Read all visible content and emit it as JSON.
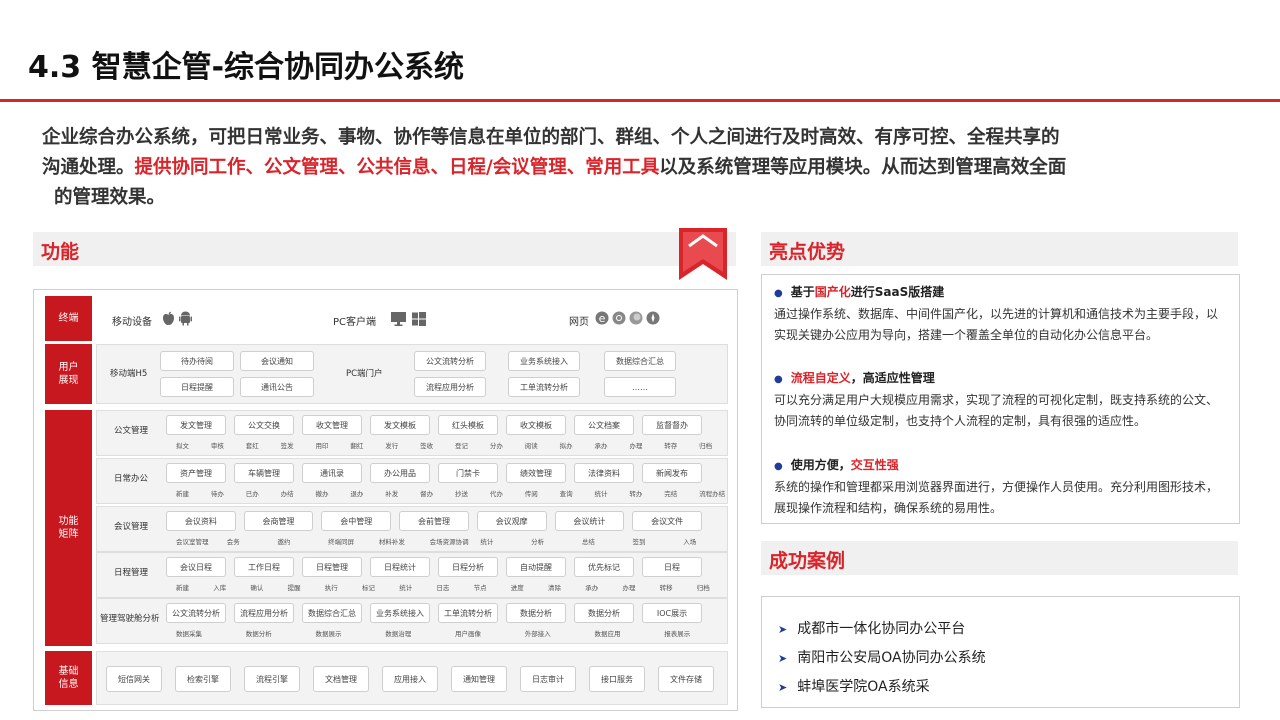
{
  "slide": {
    "title": "4.3 智慧企管-综合协同办公系统",
    "intro_line1": "企业综合办公系统，可把日常业务、事物、协作等信息在单位的部门、群组、个人之间进行及时高效、有序可控、全程共享的",
    "intro_line2_pre": "沟通处理。",
    "intro_line2_red": "提供协同工作、公文管理、公共信息、日程/会议管理、常用工具",
    "intro_line2_post": "以及系统管理等应用模块。从而达到管理高效全面",
    "intro_line3": "的管理效果。"
  },
  "function_section": {
    "title": "功能",
    "rows": {
      "terminal": {
        "label": "终端",
        "mobile": "移动设备",
        "pc": "PC客户端",
        "web": "网页"
      },
      "user_display": {
        "label": "用户\n展现",
        "left_name": "移动端H5",
        "left_items": [
          "待办待阅",
          "会议通知",
          "日程提醒",
          "通讯公告"
        ],
        "pc_portal": "PC端门户",
        "right_items": [
          "公文流转分析",
          "业务系统接入",
          "数据综合汇总",
          "流程应用分析",
          "工单流转分析",
          "……"
        ]
      },
      "function_matrix": {
        "label": "功能\n矩阵",
        "groups": [
          {
            "name": "公文管理",
            "items": [
              "发文管理",
              "公文交换",
              "收文管理",
              "发文模板",
              "红头模板",
              "收文模板",
              "公文档案",
              "监督督办"
            ],
            "subs": [
              "拟文",
              "审核",
              "套红",
              "签发",
              "用印",
              "翻红",
              "发行",
              "签收",
              "登记",
              "分办",
              "阅读",
              "拟办",
              "承办",
              "办理",
              "转存",
              "归档"
            ]
          },
          {
            "name": "日常办公",
            "items": [
              "资产管理",
              "车辆管理",
              "通讯录",
              "办公用品",
              "门禁卡",
              "绩效管理",
              "法律资料",
              "新闻发布"
            ],
            "subs": [
              "新建",
              "待办",
              "已办",
              "办结",
              "撤办",
              "退办",
              "补发",
              "督办",
              "抄送",
              "代办",
              "传阅",
              "查询",
              "统计",
              "转办",
              "完结",
              "流程办结"
            ]
          },
          {
            "name": "会议管理",
            "items": [
              "会议资料",
              "会商管理",
              "会中管理",
              "会前管理",
              "会议观摩",
              "会议统计",
              "会议文件"
            ],
            "subs": [
              "会议室管理",
              "会务",
              "邀约",
              "终端同屏",
              "材料补发",
              "会场资源协调",
              "统计",
              "分析",
              "总结",
              "签到",
              "入场"
            ]
          },
          {
            "name": "日程管理",
            "items": [
              "会议日程",
              "工作日程",
              "日程管理",
              "日程统计",
              "日程分析",
              "自动提醒",
              "优先标记",
              "日程"
            ],
            "subs": [
              "新建",
              "入库",
              "确认",
              "提醒",
              "执行",
              "标记",
              "统计",
              "日志",
              "节点",
              "进度",
              "清除",
              "承办",
              "办理",
              "转移",
              "归档"
            ]
          },
          {
            "name": "管理驾驶舱分析",
            "items": [
              "公文流转分析",
              "流程应用分析",
              "数据综合汇总",
              "业务系统接入",
              "工单流转分析",
              "数据分析",
              "数据分析",
              "IOC展示"
            ],
            "subs": [
              "数据采集",
              "数据分析",
              "数据展示",
              "数据治理",
              "用户画像",
              "外部接入",
              "数据应用",
              "报表展示"
            ]
          }
        ]
      },
      "base_info": {
        "label": "基础\n信息",
        "items": [
          "短信网关",
          "检索引擎",
          "流程引擎",
          "文档管理",
          "应用接入",
          "通知管理",
          "日志审计",
          "接口服务",
          "文件存储"
        ]
      }
    }
  },
  "highlights": {
    "title": "亮点优势",
    "items": [
      {
        "head_pre": "基于",
        "head_red": "国产化",
        "head_post": "进行SaaS版搭建",
        "body": "通过操作系统、数据库、中间件国产化，以先进的计算机和通信技术为主要手段，以实现关键办公应用为导向，搭建一个覆盖全单位的自动化办公信息平台。"
      },
      {
        "head_pre": "",
        "head_red": "流程自定义",
        "head_post": "，高适应性管理",
        "body": "可以充分满足用户大规模应用需求，实现了流程的可视化定制，既支持系统的公文、协同流转的单位级定制，也支持个人流程的定制，具有很强的适应性。"
      },
      {
        "head_pre": "使用方便，",
        "head_red": "交互性强",
        "head_post": "",
        "body": "系统的操作和管理都采用浏览器界面进行，方便操作人员使用。充分利用图形技术，展现操作流程和结构，确保系统的易用性。"
      }
    ]
  },
  "cases": {
    "title": "成功案例",
    "items": [
      "成都市一体化协同办公平台",
      "南阳市公安局OA协同办公系统",
      "蚌埠医学院OA系统采"
    ]
  },
  "colors": {
    "accent_red": "#d9242a",
    "label_red": "#c6181e",
    "bullet_blue": "#1f3c99"
  },
  "icons": [
    "apple-icon",
    "android-icon",
    "monitor-icon",
    "windows-icon",
    "edge-icon",
    "chrome-icon",
    "firefox-icon",
    "safari-icon",
    "ribbon-bookmark-icon",
    "bullet-dot-icon",
    "arrow-bullet-icon"
  ]
}
